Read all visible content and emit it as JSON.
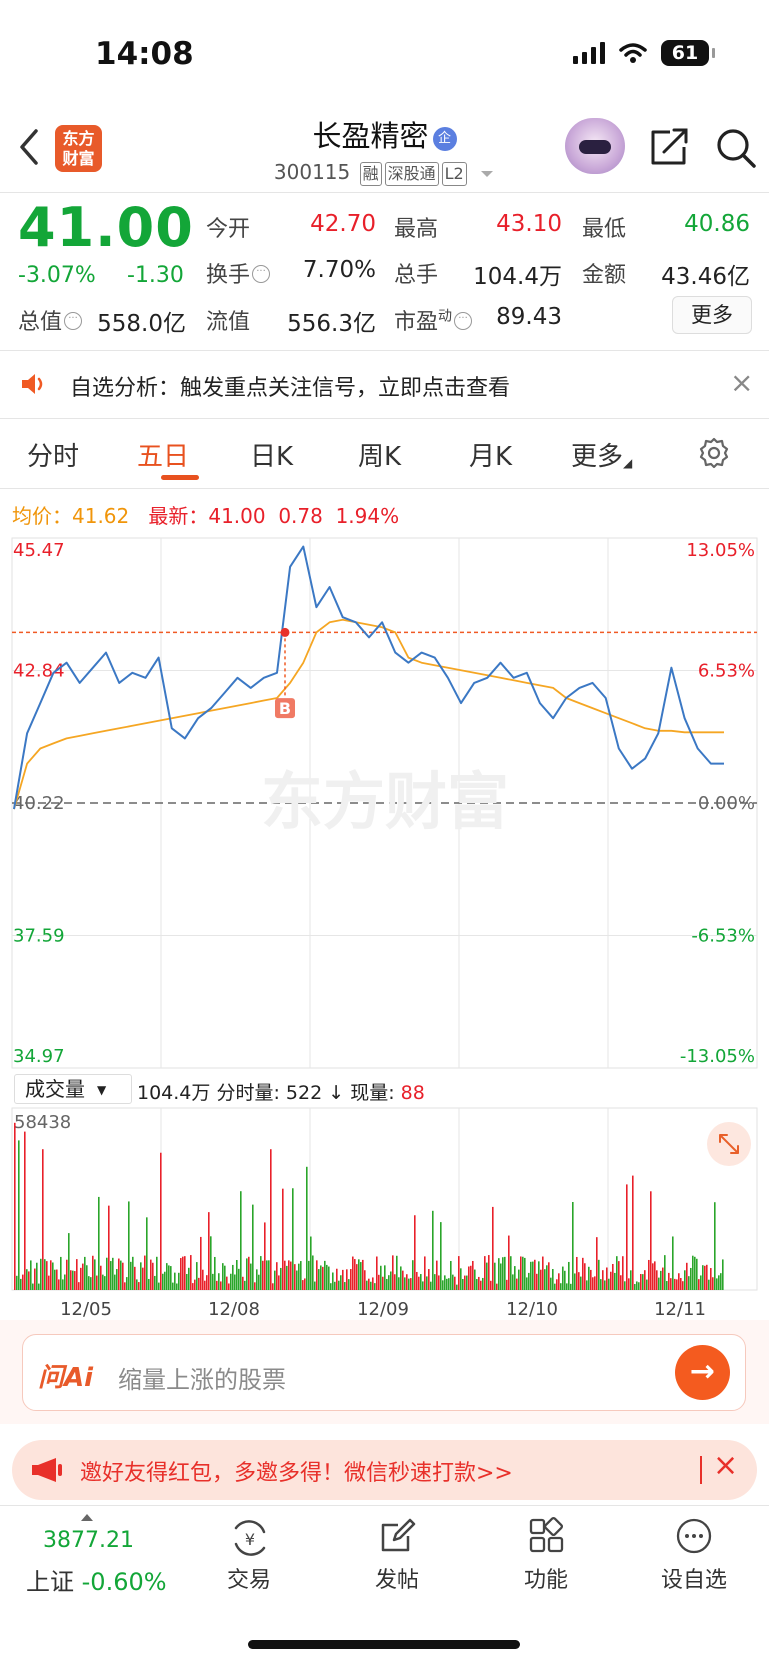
{
  "status": {
    "time": "14:08",
    "battery": "61"
  },
  "header": {
    "logo_line1": "东方",
    "logo_line2": "财富",
    "name": "长盈精密",
    "name_badge": "企",
    "code": "300115",
    "tags": [
      "融",
      "深股通",
      "L2"
    ]
  },
  "quote": {
    "price": "41.00",
    "change_pct": "-3.07%",
    "change": "-1.30",
    "open_label": "今开",
    "open": "42.70",
    "high_label": "最高",
    "high": "43.10",
    "low_label": "最低",
    "low": "40.86",
    "turnover_label": "换手",
    "turnover": "7.70%",
    "volume_label": "总手",
    "volume": "104.4万",
    "amount_label": "金额",
    "amount": "43.46亿",
    "mktcap_label": "总值",
    "mktcap": "558.0亿",
    "float_label": "流值",
    "float": "556.3亿",
    "pe_label": "市盈",
    "pe_sup": "动",
    "pe": "89.43",
    "more": "更多"
  },
  "alert": {
    "text": "自选分析：触发重点关注信号，立即点击查看"
  },
  "tabs": [
    "分时",
    "五日",
    "日K",
    "周K",
    "月K",
    "更多"
  ],
  "chart_info": {
    "avg_label": "均价：",
    "avg": "41.62",
    "latest_label": "最新：",
    "latest": "41.00",
    "diff": "0.78",
    "diff_pct": "1.94%"
  },
  "watermark": "东方财富",
  "volume_header": {
    "selector": "成交量",
    "total": "104.4万",
    "minute_label": "分时量:",
    "minute": "522",
    "now_label": "现量:",
    "now": "88"
  },
  "ask": {
    "logo": "问Ai",
    "placeholder": "缩量上涨的股票"
  },
  "invite": {
    "text": "邀好友得红包，多邀多得！微信秒速打款>>"
  },
  "bottom_nav": {
    "index_value": "3877.21",
    "index_label": "上证",
    "index_change": "-0.60%",
    "items": [
      "交易",
      "发帖",
      "功能",
      "设自选"
    ]
  },
  "colors": {
    "up": "#e8202a",
    "down": "#13a638",
    "accent": "#e8511f",
    "price_line": "#3b78c4",
    "avg_line": "#f5a623"
  },
  "chart_data": {
    "type": "line",
    "x": [
      "12/05",
      "12/08",
      "12/09",
      "12/10",
      "12/11"
    ],
    "ylim": [
      34.97,
      45.47
    ],
    "y_ticks_left": [
      "45.47",
      "42.84",
      "40.22",
      "37.59",
      "34.97"
    ],
    "y_ticks_right": [
      "13.05%",
      "6.53%",
      "0.00%",
      "-6.53%",
      "-13.05%"
    ],
    "prev_close": 40.22,
    "marker": "B",
    "series": [
      {
        "name": "price",
        "values": [
          40.1,
          41.6,
          42.2,
          42.8,
          43.0,
          42.6,
          42.9,
          43.2,
          42.6,
          42.8,
          42.7,
          43.1,
          41.7,
          41.5,
          41.9,
          42.1,
          42.4,
          42.7,
          42.5,
          42.7,
          42.8,
          44.9,
          45.3,
          44.1,
          44.5,
          43.9,
          43.8,
          43.5,
          43.8,
          43.2,
          43.0,
          43.2,
          43.1,
          42.7,
          42.2,
          42.6,
          42.7,
          43.0,
          42.7,
          42.8,
          42.2,
          41.9,
          42.3,
          42.5,
          42.6,
          42.3,
          41.3,
          40.9,
          41.1,
          41.6,
          42.9,
          41.9,
          41.3,
          41.0,
          41.0
        ],
        "color": "#3b78c4"
      },
      {
        "name": "avg",
        "values": [
          40.1,
          41.0,
          41.3,
          41.4,
          41.5,
          41.55,
          41.6,
          41.65,
          41.7,
          41.75,
          41.8,
          41.85,
          41.9,
          41.95,
          42.0,
          42.05,
          42.1,
          42.15,
          42.2,
          42.25,
          42.3,
          42.6,
          43.0,
          43.6,
          43.8,
          43.85,
          43.8,
          43.75,
          43.7,
          43.6,
          43.1,
          43.0,
          42.95,
          42.9,
          42.85,
          42.8,
          42.75,
          42.7,
          42.65,
          42.6,
          42.55,
          42.5,
          42.3,
          42.2,
          42.1,
          42.0,
          41.9,
          41.8,
          41.7,
          41.65,
          41.65,
          41.62,
          41.62,
          41.62,
          41.62
        ],
        "color": "#f5a623"
      }
    ],
    "volume_max": 58438
  }
}
